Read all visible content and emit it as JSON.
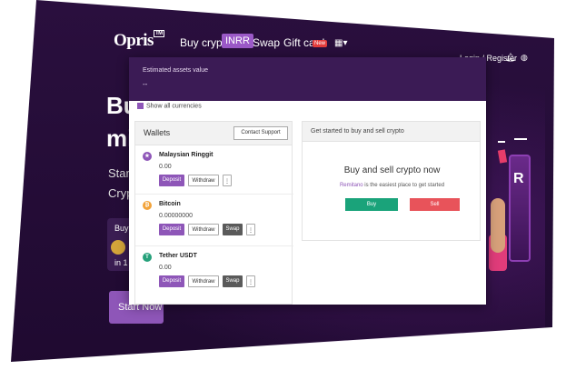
{
  "header": {
    "logo": "Opris",
    "logo_tm": "TM",
    "nav": {
      "buy_crypto": "Buy crypto",
      "inrr": "INRR",
      "swap": "Swap",
      "gift_card": "Gift card",
      "new_badge": "New"
    },
    "login": "Login / Register"
  },
  "hero": {
    "line1": "Bu",
    "line2": "mi",
    "start": "Start",
    "crypt": "Crypt",
    "promo_buy": "Buy",
    "promo_in": "in 1",
    "start_now": "Start Now"
  },
  "assets": {
    "label": "Estimated assets value",
    "value": "--"
  },
  "show_all_currencies": "Show all currencies",
  "wallets": {
    "title": "Wallets",
    "contact_support": "Contact Support",
    "items": [
      {
        "name": "Malaysian Ringgit",
        "balance": "0.00",
        "deposit": "Deposit",
        "withdraw": "Withdraw",
        "more": "⋮",
        "icon": "ringgit-icon",
        "color": "#8e56b8"
      },
      {
        "name": "Bitcoin",
        "balance": "0.00000000",
        "deposit": "Deposit",
        "withdraw": "Withdraw",
        "swap": "Swap",
        "more": "⋮",
        "icon": "bitcoin-icon",
        "color": "#f2a33a"
      },
      {
        "name": "Tether USDT",
        "balance": "0.00",
        "deposit": "Deposit",
        "withdraw": "Withdraw",
        "swap": "Swap",
        "more": "⋮",
        "icon": "tether-icon",
        "color": "#26a17b"
      }
    ]
  },
  "get_started": {
    "title": "Get started to buy and sell crypto",
    "heading": "Buy and sell crypto now",
    "brand": "Remitano",
    "subtitle_rest": " is the easiest place to get started",
    "buy": "Buy",
    "sell": "Sell"
  },
  "colors": {
    "accent": "#8e56b8",
    "dark_bg": "#2a0f3e",
    "buy": "#1aa37a",
    "sell": "#e8535a"
  }
}
